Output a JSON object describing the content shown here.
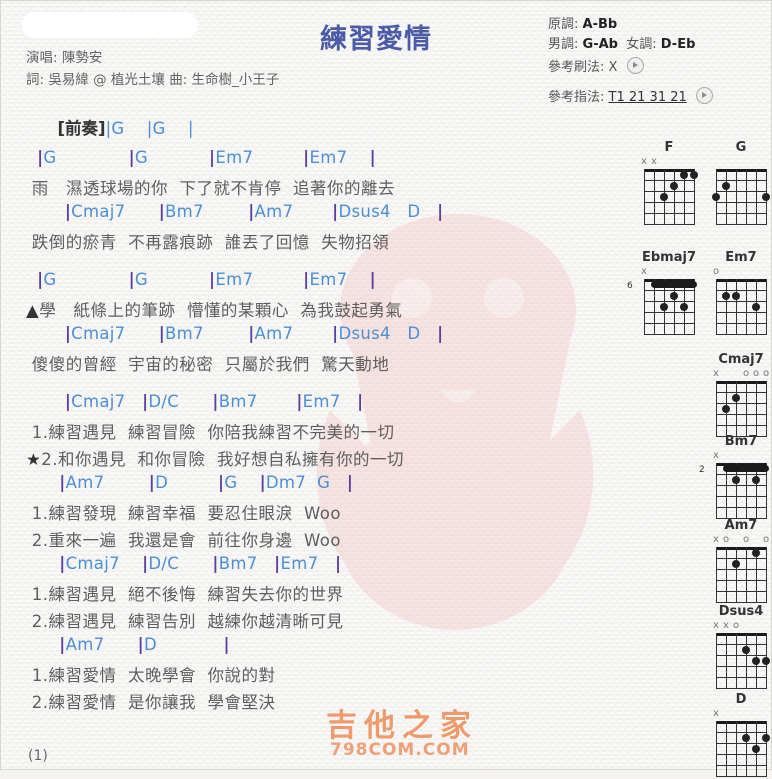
{
  "title": "練習愛情",
  "credits": {
    "singer": "演唱: 陳勢安",
    "writers": "詞: 吳易緯 @ 植光土壤  曲: 生命樹_小王子"
  },
  "meta": {
    "original_key_label": "原調:",
    "original_key": "A-Bb",
    "male_key_label": "男調:",
    "male_key": "G-Ab",
    "female_key_label": "女調:",
    "female_key": "D-Eb",
    "strum_label": "參考刷法:",
    "strum_value": "X",
    "pick_label": "參考指法:",
    "pick_value": "T1 21 31 21"
  },
  "intro": {
    "section": "[前奏]",
    "chords": "|G    |G    |"
  },
  "sheet": [
    {
      "type": "chord",
      "text": "  |G             |G           |Em7         |Em7    |"
    },
    {
      "type": "lyric",
      "text": " 雨   濕透球場的你  下了就不肯停  追著你的離去"
    },
    {
      "type": "chord",
      "text": "       |Cmaj7      |Bm7        |Am7       |Dsus4   D   |"
    },
    {
      "type": "lyric",
      "text": " 跌倒的瘀青  不再露痕跡  誰丟了回憶  失物招領"
    },
    {
      "type": "gap"
    },
    {
      "type": "chord",
      "text": "  |G             |G           |Em7         |Em7    |"
    },
    {
      "type": "lyric",
      "text": "▲學   紙條上的筆跡  懵懂的某顆心  為我鼓起勇氣"
    },
    {
      "type": "chord",
      "text": "       |Cmaj7      |Bm7        |Am7       |Dsus4   D   |"
    },
    {
      "type": "lyric",
      "text": " 傻傻的曾經  宇宙的秘密  只屬於我們  驚天動地"
    },
    {
      "type": "gap"
    },
    {
      "type": "chord",
      "text": "       |Cmaj7   |D/C      |Bm7       |Em7   |"
    },
    {
      "type": "lyric",
      "text": " 1.練習遇見  練習冒險  你陪我練習不完美的一切"
    },
    {
      "type": "lyric",
      "text": "★2.和你遇見  和你冒險  我好想自私擁有你的一切"
    },
    {
      "type": "chord",
      "text": "      |Am7        |D         |G    |Dm7  G   |"
    },
    {
      "type": "lyric",
      "text": " 1.練習發現  練習幸福  要忍住眼淚  Woo"
    },
    {
      "type": "lyric",
      "text": " 2.重來一遍  我還是會  前往你身邊  Woo"
    },
    {
      "type": "chord",
      "text": "      |Cmaj7    |D/C      |Bm7   |Em7   |"
    },
    {
      "type": "lyric",
      "text": " 1.練習遇見  絕不後悔  練習失去你的世界"
    },
    {
      "type": "lyric",
      "text": " 2.練習遇見  練習告別  越練你越清晰可見"
    },
    {
      "type": "chord",
      "text": "      |Am7      |D            |"
    },
    {
      "type": "lyric",
      "text": " 1.練習愛情  太晚學會  你說的對"
    },
    {
      "type": "lyric",
      "text": " 2.練習愛情  是你讓我  學會堅決"
    }
  ],
  "diagrams": [
    {
      "name": "F",
      "fret_label": "",
      "mutes": [
        "x",
        "x",
        "",
        "",
        "",
        ""
      ],
      "dots": [
        {
          "s": 4,
          "f": 3
        },
        {
          "s": 3,
          "f": 2
        },
        {
          "s": 2,
          "f": 1
        },
        {
          "s": 1,
          "f": 1
        }
      ],
      "barre": null
    },
    {
      "name": "G",
      "fret_label": "",
      "mutes": [
        "",
        "",
        "",
        "",
        "",
        ""
      ],
      "dots": [
        {
          "s": 6,
          "f": 3
        },
        {
          "s": 5,
          "f": 2
        },
        {
          "s": 1,
          "f": 3
        }
      ],
      "barre": null
    },
    {
      "name": "Ebmaj7",
      "fret_label": "6",
      "mutes": [
        "x",
        "",
        "",
        "",
        "",
        ""
      ],
      "dots": [
        {
          "s": 3,
          "f": 2
        },
        {
          "s": 4,
          "f": 3
        },
        {
          "s": 2,
          "f": 3
        }
      ],
      "barre": {
        "f": 1,
        "from": 5,
        "to": 1
      }
    },
    {
      "name": "Em7",
      "fret_label": "",
      "mutes": [
        "o",
        "",
        "",
        "",
        "",
        ""
      ],
      "dots": [
        {
          "s": 5,
          "f": 2
        },
        {
          "s": 4,
          "f": 2
        },
        {
          "s": 2,
          "f": 3
        }
      ],
      "barre": null
    },
    {
      "name": "Cmaj7",
      "fret_label": "",
      "mutes": [
        "x",
        "",
        "",
        "o",
        "o",
        "o"
      ],
      "dots": [
        {
          "s": 5,
          "f": 3
        },
        {
          "s": 4,
          "f": 2
        }
      ],
      "barre": null
    },
    {
      "name": "Bm7",
      "fret_label": "2",
      "mutes": [
        "x",
        "",
        "",
        "",
        "",
        ""
      ],
      "dots": [
        {
          "s": 4,
          "f": 2
        },
        {
          "s": 2,
          "f": 2
        }
      ],
      "barre": {
        "f": 1,
        "from": 5,
        "to": 1
      }
    },
    {
      "name": "Am7",
      "fret_label": "",
      "mutes": [
        "x",
        "o",
        "",
        "o",
        "",
        "o"
      ],
      "dots": [
        {
          "s": 4,
          "f": 2
        },
        {
          "s": 2,
          "f": 1
        }
      ],
      "barre": null
    },
    {
      "name": "Dsus4",
      "fret_label": "",
      "mutes": [
        "x",
        "x",
        "o",
        "",
        "",
        ""
      ],
      "dots": [
        {
          "s": 3,
          "f": 2
        },
        {
          "s": 2,
          "f": 3
        },
        {
          "s": 1,
          "f": 3
        }
      ],
      "barre": null
    },
    {
      "name": "D",
      "fret_label": "",
      "mutes": [
        "x",
        "",
        "",
        "",
        "",
        ""
      ],
      "dots": [
        {
          "s": 3,
          "f": 2
        },
        {
          "s": 2,
          "f": 3
        },
        {
          "s": 1,
          "f": 2
        }
      ],
      "barre": null
    }
  ],
  "watermark": {
    "logo": "吉他之家",
    "url": "798COM.COM"
  },
  "page_number": "(1)"
}
